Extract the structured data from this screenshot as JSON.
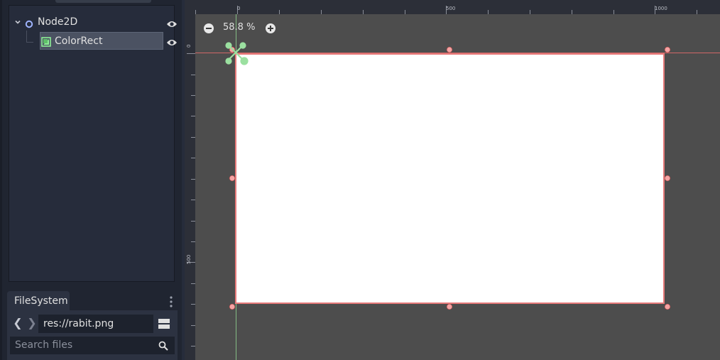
{
  "scene_tree": {
    "nodes": [
      {
        "name": "Node2D",
        "type_icon": "node2d-icon",
        "visible": true,
        "expanded": true
      },
      {
        "name": "ColorRect",
        "type_icon": "colorrect-icon",
        "visible": true,
        "selected": true
      }
    ]
  },
  "filesystem": {
    "tab_label": "FileSystem",
    "path": "res://rabit.png",
    "search_placeholder": "Search files"
  },
  "viewport": {
    "zoom": "58.8 %",
    "ruler_top_labels": [
      "0",
      "500",
      "1000"
    ],
    "ruler_left_labels": [
      "0",
      "500"
    ]
  },
  "colors": {
    "selection_outline": "#e67a7a",
    "handle_fill": "#f4a3a3",
    "pivot": "#9be0a0",
    "rect_fill": "#ffffff",
    "viewport_bg": "#4d4d4d"
  }
}
